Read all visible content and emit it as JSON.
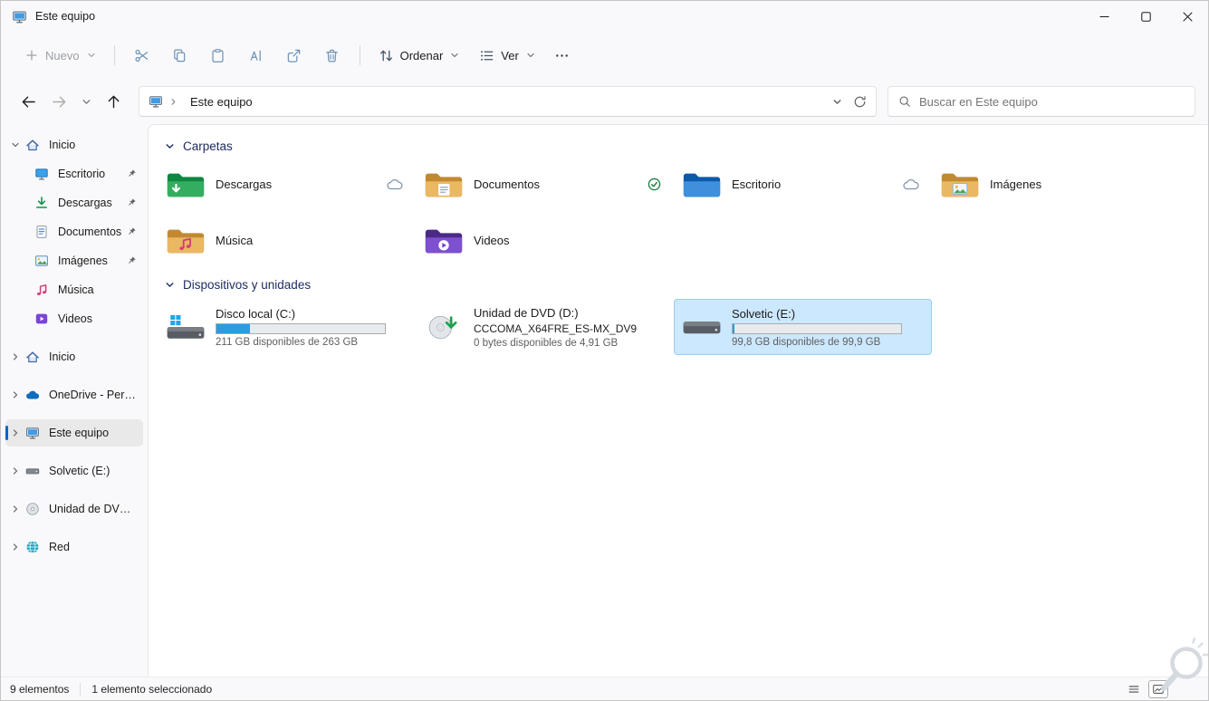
{
  "window": {
    "title": "Este equipo"
  },
  "toolbar": {
    "new_label": "Nuevo",
    "sort_label": "Ordenar",
    "view_label": "Ver",
    "edit_buttons": [
      {
        "name": "cut-button",
        "icon": "scissors-icon"
      },
      {
        "name": "copy-button",
        "icon": "copy-icon"
      },
      {
        "name": "paste-button",
        "icon": "paste-icon"
      },
      {
        "name": "rename-button",
        "icon": "rename-icon"
      },
      {
        "name": "share-button",
        "icon": "share-icon"
      },
      {
        "name": "delete-button",
        "icon": "delete-icon"
      }
    ]
  },
  "navbar": {
    "breadcrumb": "Este equipo",
    "search_placeholder": "Buscar en Este equipo"
  },
  "sidebar": {
    "items": [
      {
        "label": "Inicio",
        "icon": "home-icon",
        "expander": "down",
        "pinned": false,
        "indent": 0,
        "selected": false,
        "gap": false
      },
      {
        "label": "Escritorio",
        "icon": "desktop-icon",
        "expander": null,
        "pinned": true,
        "indent": 1,
        "selected": false,
        "gap": false
      },
      {
        "label": "Descargas",
        "icon": "downloads-icon",
        "expander": null,
        "pinned": true,
        "indent": 1,
        "selected": false,
        "gap": false
      },
      {
        "label": "Documentos",
        "icon": "documents-icon",
        "expander": null,
        "pinned": true,
        "indent": 1,
        "selected": false,
        "gap": false
      },
      {
        "label": "Imágenes",
        "icon": "pictures-icon",
        "expander": null,
        "pinned": true,
        "indent": 1,
        "selected": false,
        "gap": false
      },
      {
        "label": "Música",
        "icon": "music-icon",
        "expander": null,
        "pinned": false,
        "indent": 1,
        "selected": false,
        "gap": false
      },
      {
        "label": "Videos",
        "icon": "videos-icon",
        "expander": null,
        "pinned": false,
        "indent": 1,
        "selected": false,
        "gap": false
      },
      {
        "label": "Inicio",
        "icon": "home-icon",
        "expander": "right",
        "pinned": false,
        "indent": 0,
        "selected": false,
        "gap": true
      },
      {
        "label": "OneDrive - Personal",
        "icon": "onedrive-icon",
        "expander": "right",
        "pinned": false,
        "indent": 0,
        "selected": false,
        "gap": true
      },
      {
        "label": "Este equipo",
        "icon": "computer-icon",
        "expander": "right",
        "pinned": false,
        "indent": 0,
        "selected": true,
        "gap": true
      },
      {
        "label": "Solvetic (E:)",
        "icon": "drive-icon",
        "expander": "right",
        "pinned": false,
        "indent": 0,
        "selected": false,
        "gap": true
      },
      {
        "label": "Unidad de DVD (D:)",
        "icon": "dvd-icon",
        "expander": "right",
        "pinned": false,
        "indent": 0,
        "selected": false,
        "gap": true
      },
      {
        "label": "Red",
        "icon": "network-icon",
        "expander": "right",
        "pinned": false,
        "indent": 0,
        "selected": false,
        "gap": true
      }
    ]
  },
  "content": {
    "sections": [
      {
        "title": "Carpetas",
        "type": "folders",
        "items": [
          {
            "name": "Descargas",
            "icon": "folder-downloads-icon",
            "status": "cloud-status-icon"
          },
          {
            "name": "Documentos",
            "icon": "folder-documents-icon",
            "status": "check-status-icon"
          },
          {
            "name": "Escritorio",
            "icon": "folder-desktop-icon",
            "status": "cloud-status-icon"
          },
          {
            "name": "Imágenes",
            "icon": "folder-pictures-icon",
            "status": null
          },
          {
            "name": "Música",
            "icon": "folder-music-icon",
            "status": null
          },
          {
            "name": "Videos",
            "icon": "folder-videos-icon",
            "status": null
          }
        ]
      },
      {
        "title": "Dispositivos y unidades",
        "type": "drives",
        "items": [
          {
            "name": "Disco local (C:)",
            "icon": "windows-drive-large-icon",
            "subtitle": null,
            "bar_percent": 20,
            "free_text": "211 GB disponibles de 263 GB",
            "selected": false
          },
          {
            "name": "Unidad de DVD (D:)",
            "icon": "dvd-large-icon",
            "subtitle": "CCCOMA_X64FRE_ES-MX_DV9",
            "bar_percent": null,
            "free_text": "0 bytes disponibles de 4,91 GB",
            "selected": false
          },
          {
            "name": "Solvetic (E:)",
            "icon": "hard-drive-large-icon",
            "subtitle": null,
            "bar_percent": 1,
            "free_text": "99,8 GB disponibles de 99,9 GB",
            "selected": true
          }
        ]
      }
    ]
  },
  "statusbar": {
    "items_count": "9 elementos",
    "selection": "1 elemento seleccionado"
  },
  "colors": {
    "accent": "#0067c0",
    "selection_bg": "#cce8ff",
    "selection_border": "#99ccf2",
    "usage_bar_fill": "#2f9ae0"
  }
}
